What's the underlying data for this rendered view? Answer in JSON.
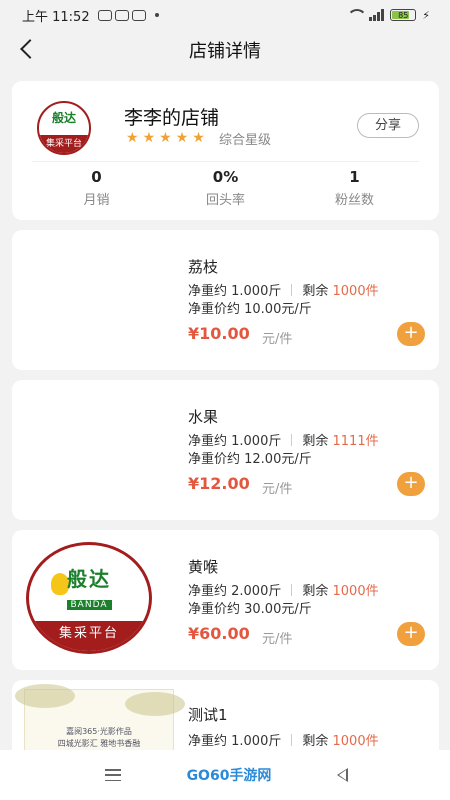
{
  "status": {
    "time": "上午 11:52",
    "battery": "85"
  },
  "nav": {
    "title": "店铺详情"
  },
  "shop": {
    "name": "李李的店铺",
    "rating_label": "综合星级",
    "share_label": "分享",
    "logo_text": "般达",
    "logo_band": "集采平台",
    "stats": [
      {
        "value": "0",
        "label": "月销"
      },
      {
        "value": "0%",
        "label": "回头率"
      },
      {
        "value": "1",
        "label": "粉丝数"
      }
    ]
  },
  "products": [
    {
      "name": "荔枝",
      "weight": "净重约 1.000斤",
      "stock_label": "剩余",
      "stock": "1000件",
      "unit_price": "净重价约 10.00元/斤",
      "price": "¥10.00",
      "unit": "元/件"
    },
    {
      "name": "水果",
      "weight": "净重约 1.000斤",
      "stock_label": "剩余",
      "stock": "1111件",
      "unit_price": "净重价约 12.00元/斤",
      "price": "¥12.00",
      "unit": "元/件"
    },
    {
      "name": "黄喉",
      "weight": "净重约 2.000斤",
      "stock_label": "剩余",
      "stock": "1000件",
      "unit_price": "净重价约 30.00元/斤",
      "price": "¥60.00",
      "unit": "元/件",
      "logo_cn": "般达",
      "logo_en": "BANDA",
      "logo_band": "集采平台"
    },
    {
      "name": "测试1",
      "weight": "净重约 1.000斤",
      "stock_label": "剩余",
      "stock": "1000件",
      "poster_line1": "嘉阅365·光影作品",
      "poster_line2": "四城光影汇  雅地书香融"
    }
  ],
  "bottom": {
    "watermark": "GO60手游网"
  },
  "colors": {
    "accent": "#f0a03c",
    "price": "#e4573f",
    "brand_red": "#a31d1d",
    "brand_green": "#1b7f2b"
  }
}
